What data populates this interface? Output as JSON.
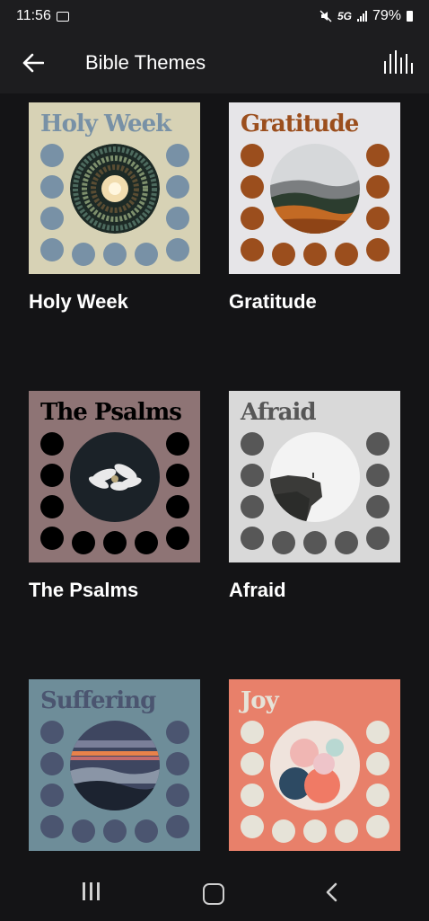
{
  "status_bar": {
    "time": "11:56",
    "network": "5G",
    "battery": "79%"
  },
  "app_bar": {
    "title": "Bible Themes"
  },
  "themes": [
    {
      "title": "Holy Week",
      "cover_title": "Holy Week",
      "bg": "#d7d2b5",
      "dot": "#7891a6",
      "title_color": "#7891a6",
      "image": "stained-glass-dome"
    },
    {
      "title": "Gratitude",
      "cover_title": "Gratitude",
      "bg": "#e6e5e8",
      "dot": "#9b4e1d",
      "title_color": "#9b4e1d",
      "image": "autumn-forest"
    },
    {
      "title": "The Psalms",
      "cover_title": "The Psalms",
      "bg": "#8e7475",
      "dot": "#000000",
      "title_color": "#000000",
      "image": "white-lilies"
    },
    {
      "title": "Afraid",
      "cover_title": "Afraid",
      "bg": "#d9d9d9",
      "dot": "#575757",
      "title_color": "#575757",
      "image": "cliff-edge"
    },
    {
      "title": "",
      "cover_title": "Suffering",
      "bg": "#6e8d99",
      "dot": "#4b5570",
      "title_color": "#4b5570",
      "image": "sunset-clouds"
    },
    {
      "title": "",
      "cover_title": "Joy",
      "bg": "#e8806a",
      "dot": "#e6e3d8",
      "title_color": "#e6e3d8",
      "image": "balloons"
    }
  ]
}
